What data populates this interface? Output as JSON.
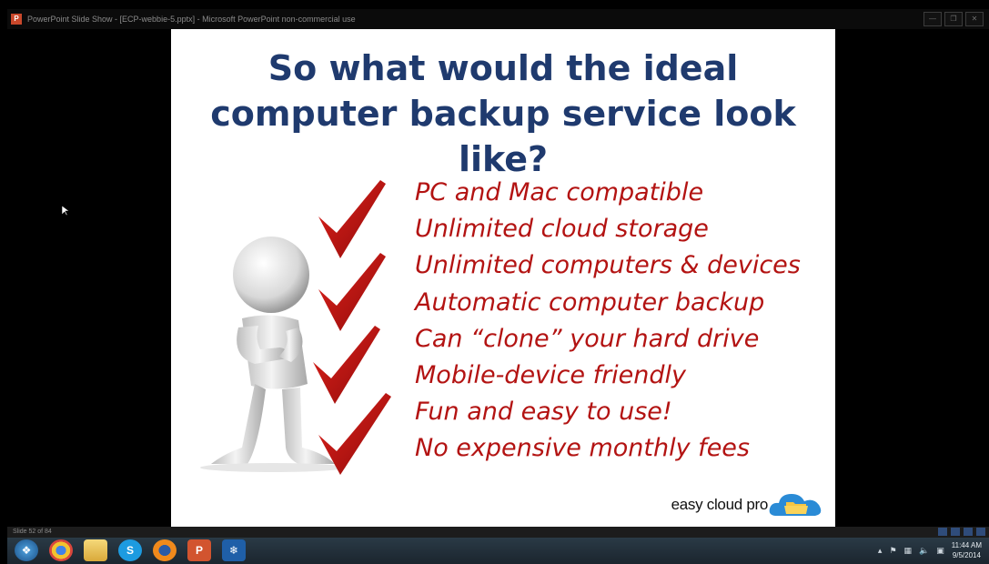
{
  "window": {
    "title": "PowerPoint Slide Show - [ECP-webbie-5.pptx] - Microsoft PowerPoint non-commercial use",
    "app_icon_letter": "P"
  },
  "slide": {
    "title": "So what would the ideal computer backup service look like?",
    "bullets": [
      "PC and Mac compatible",
      "Unlimited  cloud storage",
      "Unlimited computers & devices",
      "Automatic computer backup",
      "Can “clone” your hard drive",
      "Mobile-device friendly",
      "Fun and easy to use!",
      "No expensive monthly fees"
    ],
    "logo_text": "easy cloud pro",
    "colors": {
      "title": "#1f3a6e",
      "bullets": "#b31312",
      "checkmark": "#c41210"
    }
  },
  "statusbar": {
    "slide_counter": "Slide 52 of 84"
  },
  "taskbar": {
    "apps": [
      "windows-start",
      "chrome",
      "file-explorer",
      "skype",
      "firefox",
      "powerpoint",
      "snowflake-app"
    ],
    "clock_time": "11:44 AM",
    "clock_date": "9/5/2014"
  }
}
